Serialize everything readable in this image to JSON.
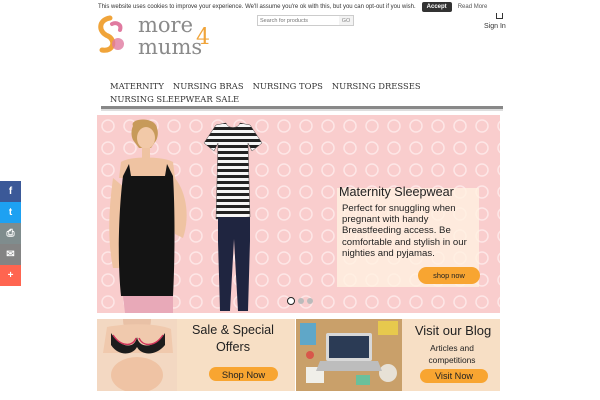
{
  "cookie": {
    "text": "This website uses cookies to improve your experience. We'll assume you're ok with this, but you can opt-out if you wish.",
    "accept_label": "Accept",
    "read_more_label": "Read More"
  },
  "header": {
    "logo_text_top": "more",
    "logo_text_bottom": "mums",
    "logo_number": "4",
    "search_placeholder": "Search for products",
    "search_button": "GO",
    "signin_label": "Sign In"
  },
  "nav": {
    "items": [
      "MATERNITY",
      "NURSING BRAS",
      "NURSING TOPS",
      "NURSING DRESSES",
      "NURSING SLEEPWEAR",
      "SALE"
    ]
  },
  "hero": {
    "title": "Maternity Sleepwear",
    "description": "Perfect for snuggling when pregnant with handy Breastfeeding access. Be comfortable and stylish in our nighties and pyjamas.",
    "button_label": "shop now",
    "slides_total": 3,
    "active_slide": 1
  },
  "promos": {
    "sale_title_line1": "Sale & Special",
    "sale_title_line2": "Offers",
    "sale_button": "Shop Now",
    "blog_title": "Visit our Blog",
    "blog_sub_line1": "Articles and",
    "blog_sub_line2": "competitions",
    "blog_button": "Visit Now"
  },
  "share": [
    {
      "icon": "facebook-icon",
      "glyph": "f",
      "color": "#3b5998"
    },
    {
      "icon": "twitter-icon",
      "glyph": "t",
      "color": "#1da1f2"
    },
    {
      "icon": "print-icon",
      "glyph": "⎙",
      "color": "#7f8c8d"
    },
    {
      "icon": "email-icon",
      "glyph": "✉",
      "color": "#848484"
    },
    {
      "icon": "more-share-icon",
      "glyph": "+",
      "color": "#ff6550"
    }
  ],
  "colors": {
    "accent": "#f8a531",
    "hero_bg": "#f9cdcd",
    "promo_bg": "#f7dfc5"
  }
}
